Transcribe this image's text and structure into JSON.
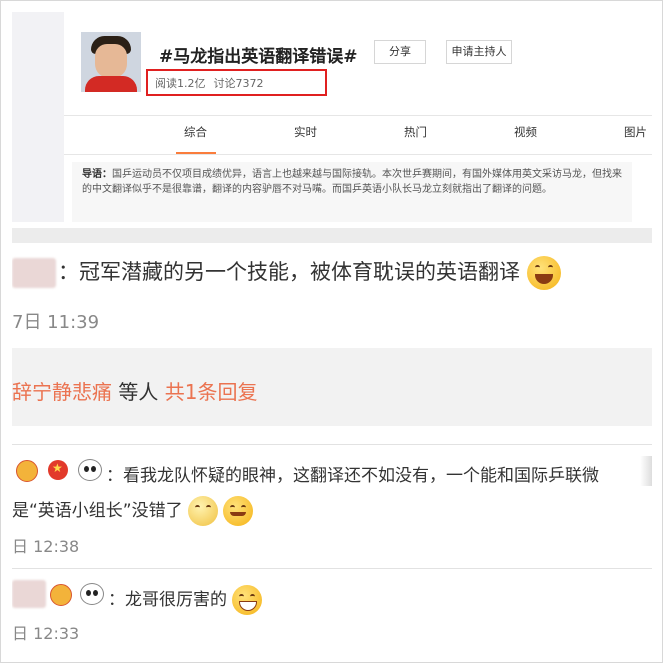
{
  "topic": {
    "title": "#马龙指出英语翻译错误#",
    "share_label": "分享",
    "host_label": "申请主持人",
    "reads": "阅读1.2亿",
    "discussions": "讨论7372"
  },
  "tabs": [
    "综合",
    "实时",
    "热门",
    "视频",
    "图片"
  ],
  "active_tab": "综合",
  "guide": {
    "label": "导语：",
    "text": "国乒运动员不仅项目成绩优异，语言上也越来越与国际接轨。本次世乒赛期间，有国外媒体用英文采访马龙，但找来的中文翻译似乎不是很靠谱，翻译的内容驴唇不对马嘴。而国乒英语小队长马龙立刻就指出了翻译的问题。"
  },
  "comments": [
    {
      "text": "：冠军潜藏的另一个技能，被体育耽误的英语翻译",
      "time": "7日 11:39",
      "emoji": "laughing-emoji"
    }
  ],
  "reply_summary": {
    "name": "辞宁静悲痛",
    "others": " 等人 ",
    "count": "共1条回复"
  },
  "replies": [
    {
      "line1": "：看我龙队怀疑的眼神，这翻译还不如没有，一个能和国际乒联微",
      "line2": "是“英语小组长”没错了",
      "time": "日 12:38"
    },
    {
      "line1": "：龙哥很厉害的",
      "time": "日 12:33"
    }
  ],
  "colors": {
    "accent_orange": "#fa7d3c",
    "link_orange": "#eb7350",
    "highlight_red": "#e02020"
  }
}
